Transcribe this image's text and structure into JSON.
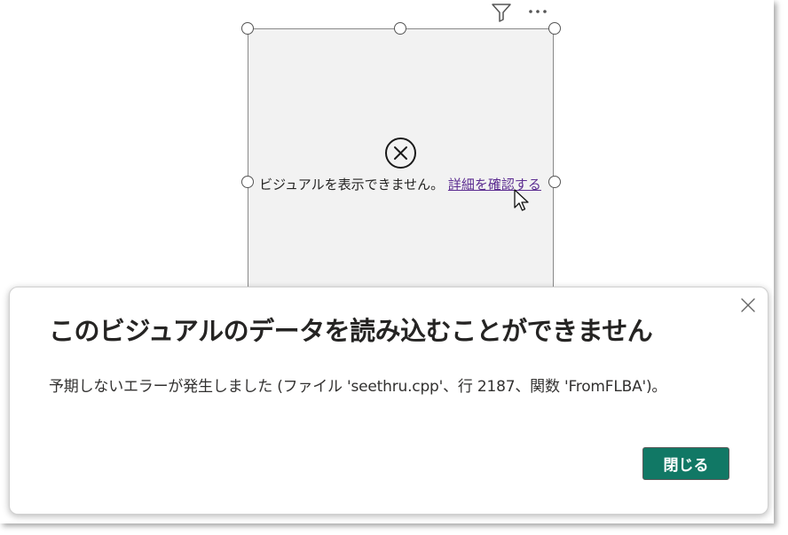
{
  "visual": {
    "error_message": "ビジュアルを表示できません。",
    "details_link": "詳細を確認する",
    "header_icons": [
      "filter-icon",
      "more-options-icon"
    ],
    "status_icon": "error-circle-x-icon"
  },
  "dialog": {
    "title": "このビジュアルのデータを読み込むことができません",
    "body": "予期しないエラーが発生しました (ファイル 'seethru.cpp'、行 2187、関数 'FromFLBA')。",
    "close_button_label": "閉じる",
    "close_icon": "close-icon"
  },
  "colors": {
    "link": "#5c2d91",
    "button_bg": "#117865",
    "visual_bg": "#f2f2f2"
  }
}
